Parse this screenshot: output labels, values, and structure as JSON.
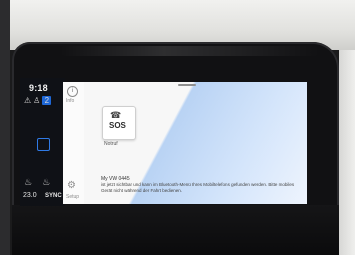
{
  "status": {
    "time": "9:18",
    "icons": [
      "warning-icon",
      "person-icon",
      "badge-icon"
    ],
    "badge": "2"
  },
  "climate": {
    "temperature": "23.0",
    "sync_label": "SYNC"
  },
  "nav": {
    "info_label": "Info",
    "setup_label": "Setup"
  },
  "tile": {
    "icon_text": "SOS",
    "label": "Notruf"
  },
  "notice": {
    "title": "My VW 0445",
    "body": "ist jetzt sichtbar und kann im Bluetooth-Menü Ihres Mobiltelefons gefunden werden. Bitte mobiles Gerät nicht während der Fahrt bedienen."
  },
  "colors": {
    "accent": "#1e67d6",
    "screen_background": "#f7f7f7",
    "blue_panel": "#c8dcf8"
  }
}
